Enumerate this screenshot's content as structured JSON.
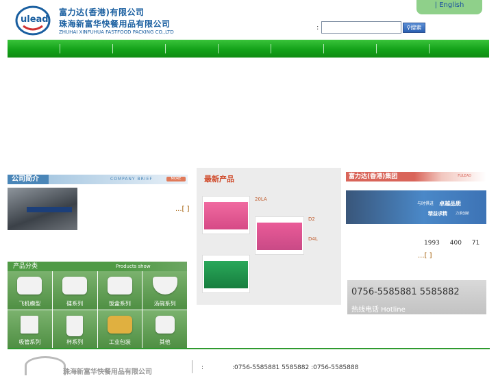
{
  "header": {
    "company_cn_1": "富力达(香港)有限公司",
    "company_cn_2": "珠海新富华快餐用品有限公司",
    "company_en": "ZHUHAI XINFUHUA FASTFOOD PACKING CO.,LTD",
    "logo_text": "Fulead",
    "language_link": "| English",
    "search_colon": ":",
    "search_placeholder": "",
    "search_button": "搜索"
  },
  "nav": {
    "items": [
      "",
      "",
      "",
      "",
      "",
      "",
      "",
      "",
      ""
    ]
  },
  "company": {
    "title": "公司简介",
    "title_en": "COMPANY BRIEF",
    "more_badge": "MORE",
    "more_link": "...[ ]"
  },
  "products": {
    "title": "产品分类",
    "title_en": "Products show",
    "categories": [
      "飞机模型",
      "碟系列",
      "饭盒系列",
      "汤碗系列",
      "吸管系列",
      "杯系列",
      "工业包装",
      "其他"
    ]
  },
  "newest": {
    "title": "最新产品",
    "items": [
      {
        "label": "20LA"
      },
      {
        "label": "D2"
      },
      {
        "label": "D4L"
      }
    ]
  },
  "group": {
    "title": "富力达(香港)集团",
    "title_en": "FULEAD",
    "banner_line1": "与时俱进",
    "banner_line2": "卓越品质",
    "banner_line3": "精益求精",
    "banner_line4": "力求创新",
    "text": "1993 400 71",
    "more_link": "...[ ]"
  },
  "hotline": {
    "numbers": "0756-5585881  5585882",
    "label": "热线电话 Hotline"
  },
  "footer": {
    "company": "珠海新富华快餐用品有限公司",
    "colon": ":",
    "contact": ":0756-5585881 5585882  :0756-5585888"
  }
}
